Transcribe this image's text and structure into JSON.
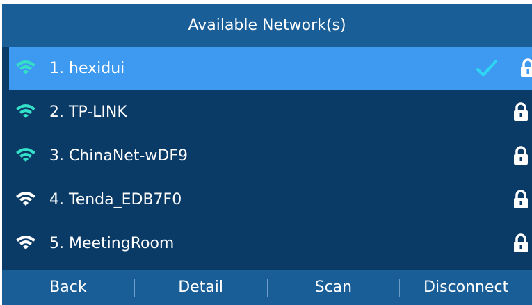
{
  "header": {
    "title": "Available Network(s)"
  },
  "networks": [
    {
      "index": "1.",
      "ssid": "hexidui",
      "selected": true,
      "connected": true,
      "secured": true,
      "icon": "wifi-icon"
    },
    {
      "index": "2.",
      "ssid": "TP-LINK",
      "selected": false,
      "connected": false,
      "secured": true,
      "icon": "wifi-icon"
    },
    {
      "index": "3.",
      "ssid": "ChinaNet-wDF9",
      "selected": false,
      "connected": false,
      "secured": true,
      "icon": "wifi-icon"
    },
    {
      "index": "4.",
      "ssid": "Tenda_EDB7F0",
      "selected": false,
      "connected": false,
      "secured": true,
      "icon": "wifi-icon"
    },
    {
      "index": "5.",
      "ssid": "MeetingRoom",
      "selected": false,
      "connected": false,
      "secured": true,
      "icon": "wifi-icon"
    }
  ],
  "softkeys": {
    "back": "Back",
    "detail": "Detail",
    "scan": "Scan",
    "disconnect": "Disconnect"
  },
  "colors": {
    "background": "#0a3a66",
    "header": "#1a5e98",
    "selected_row": "#3d9af0",
    "wifi_normal": "#35e0c8",
    "wifi_dim": "#ffffff",
    "text": "#ffffff"
  }
}
